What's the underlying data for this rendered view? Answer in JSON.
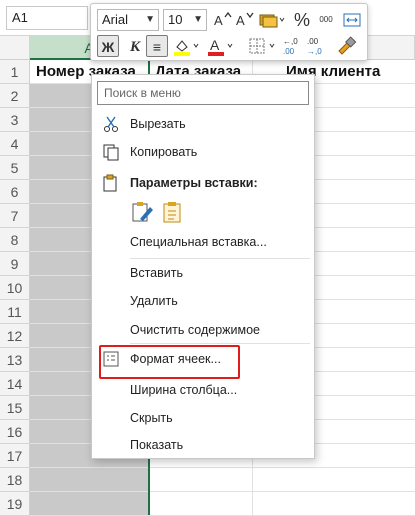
{
  "name_box": "A1",
  "columns": {
    "A": "A"
  },
  "rows": [
    "1",
    "2",
    "3",
    "4",
    "5",
    "6",
    "7",
    "8",
    "9",
    "10",
    "11",
    "12",
    "13",
    "14",
    "15",
    "16",
    "17",
    "18",
    "19"
  ],
  "header_cells": {
    "a1": "Номер заказа",
    "b1": "Дата заказа",
    "c1": "Имя клиента"
  },
  "toolbar": {
    "font": "Arial",
    "size": "10",
    "grow_font": "A^",
    "shrink_font": "A˅",
    "percent": "%",
    "thousands": "000",
    "bold": "Ж",
    "align": "≡",
    "font_color": "A",
    "inc_decimal": "←,0 .00",
    "dec_decimal": ".00 →,0"
  },
  "menu": {
    "search_placeholder": "Поиск в меню",
    "cut": "Вырезать",
    "copy": "Копировать",
    "paste_options": "Параметры вставки:",
    "paste_special": "Специальная вставка...",
    "insert": "Вставить",
    "delete": "Удалить",
    "clear": "Очистить содержимое",
    "format_cells": "Формат ячеек...",
    "col_width": "Ширина столбца...",
    "hide": "Скрыть",
    "show": "Показать"
  },
  "colors": {
    "accent": "#1e7145",
    "highlight": "#e01b1b"
  }
}
